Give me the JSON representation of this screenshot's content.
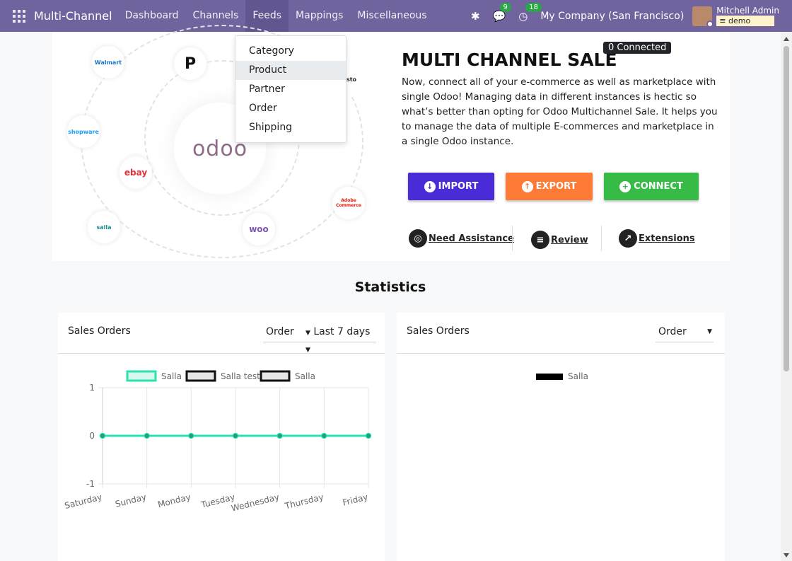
{
  "navbar": {
    "brand": "Multi-Channel",
    "menu": [
      "Dashboard",
      "Channels",
      "Feeds",
      "Mappings",
      "Miscellaneous"
    ],
    "messages_count": "9",
    "activities_count": "18",
    "company": "My Company (San Francisco)",
    "user_name": "Mitchell Admin",
    "database": "demo"
  },
  "feeds_menu": [
    "Category",
    "Product",
    "Partner",
    "Order",
    "Shipping"
  ],
  "hero": {
    "title": "MULTI CHANNEL SALE",
    "connected_badge": "0 Connected",
    "description": "Now, connect all of your e-commerce as well as marketplace with single Odoo! Managing data in different instances is hectic so what’s better than opting for Odoo Multichannel Sale. It helps you to manage the data of multiple E-commerces and marketplace in a single Odoo instance.",
    "center_logo": "odoo",
    "channels": [
      "Walmart",
      "shopware",
      "ebay",
      "salla",
      "woo",
      "Adobe Commerce",
      "sto"
    ],
    "buttons": {
      "import": "IMPORT",
      "export": "EXPORT",
      "connect": "CONNECT"
    },
    "links": {
      "assistance": "Need Assistance",
      "review": "Review",
      "extensions": "Extensions"
    }
  },
  "statistics": {
    "title": "Statistics",
    "left_card": {
      "title": "Sales Orders",
      "model_select": "Order",
      "period_select": "Last 7 days"
    },
    "right_card": {
      "title": "Sales Orders",
      "model_select": "Order"
    }
  },
  "colors": {
    "navbar": "#71639e",
    "import": "#4b2bd7",
    "export": "#fd7b36",
    "connect": "#35bb46",
    "series_salla": "#2de0b0"
  },
  "chart_data": [
    {
      "type": "line",
      "categories": [
        "Saturday",
        "Sunday",
        "Monday",
        "Tuesday",
        "Wednesday",
        "Thursday",
        "Friday"
      ],
      "series": [
        {
          "name": "Salla",
          "values": [
            0,
            0,
            0,
            0,
            0,
            0,
            0
          ]
        },
        {
          "name": "Salla test",
          "values": [
            0,
            0,
            0,
            0,
            0,
            0,
            0
          ]
        },
        {
          "name": "Salla",
          "values": [
            0,
            0,
            0,
            0,
            0,
            0,
            0
          ]
        }
      ],
      "ylim": [
        -1,
        1
      ],
      "yticks": [
        "1",
        "0",
        "-1"
      ],
      "grid": true,
      "legend": "top"
    },
    {
      "type": "line",
      "categories": [],
      "series": [
        {
          "name": "Salla",
          "values": []
        }
      ],
      "legend": "top"
    }
  ]
}
